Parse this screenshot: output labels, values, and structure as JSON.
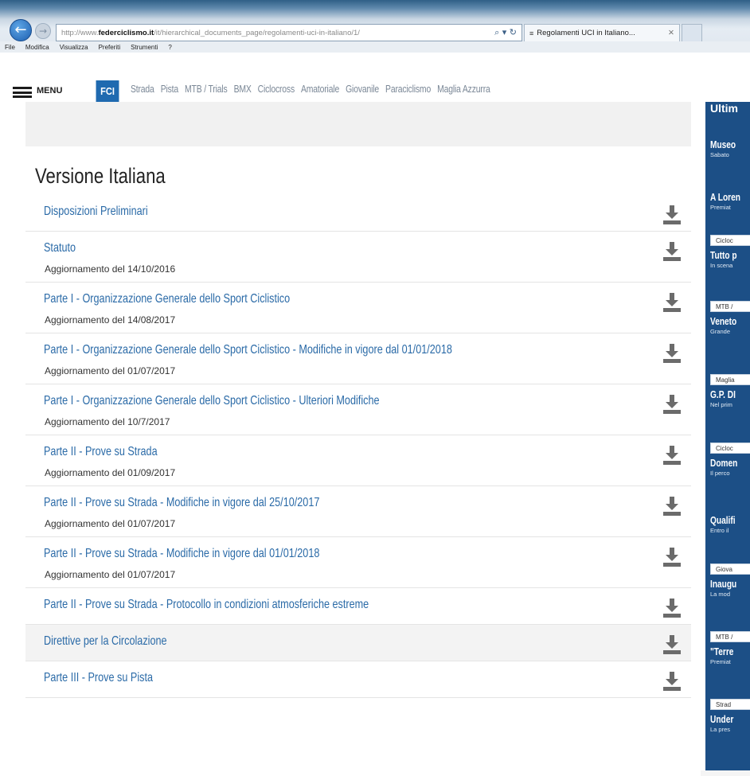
{
  "browser": {
    "url_prefix": "http://www.",
    "url_host": "federciclismo.it",
    "url_path": "/it/hierarchical_documents_page/regolamenti-uci-in-italiano/1/",
    "address_icons": "⌕ ▾ ↻",
    "tab_title": "Regolamenti UCI in Italiano...",
    "tab_close": "✕",
    "menu": [
      "File",
      "Modifica",
      "Visualizza",
      "Preferiti",
      "Strumenti",
      "?"
    ]
  },
  "site_nav": {
    "menu_label": "MENU",
    "badge": "FCI",
    "links": [
      "Strada",
      "Pista",
      "MTB / Trials",
      "BMX",
      "Ciclocross",
      "Amatoriale",
      "Giovanile",
      "Paraciclismo",
      "Maglia Azzurra"
    ]
  },
  "main": {
    "section_title": "Versione Italiana",
    "documents": [
      {
        "title": "Disposizioni Preliminari",
        "date": ""
      },
      {
        "title": "Statuto",
        "date": "Aggiornamento del 14/10/2016"
      },
      {
        "title": "Parte I - Organizzazione Generale dello Sport Ciclistico",
        "date": "Aggiornamento del 14/08/2017"
      },
      {
        "title": "Parte I - Organizzazione Generale dello Sport Ciclistico - Modifiche in vigore dal 01/01/2018",
        "date": "Aggiornamento del 01/07/2017"
      },
      {
        "title": "Parte I - Organizzazione Generale dello Sport Ciclistico - Ulteriori Modifiche",
        "date": "Aggiornamento del 10/7/2017"
      },
      {
        "title": "Parte II - Prove su Strada",
        "date": "Aggiornamento del 01/09/2017"
      },
      {
        "title": "Parte II - Prove su Strada - Modifiche in vigore dal 25/10/2017",
        "date": "Aggiornamento del 01/07/2017"
      },
      {
        "title": "Parte II - Prove su Strada - Modifiche in vigore dal 01/01/2018",
        "date": "Aggiornamento del 01/07/2017"
      },
      {
        "title": "Parte II - Prove su Strada - Protocollo in condizioni atmosferiche estreme",
        "date": ""
      },
      {
        "title": "Direttive per la Circolazione",
        "date": ""
      },
      {
        "title": "Parte III - Prove su Pista",
        "date": ""
      }
    ]
  },
  "sidebar": {
    "heading": "Ultim",
    "items": [
      {
        "title": "Museo",
        "sub": "Sabato"
      },
      {
        "title": "A Loren",
        "sub": "Premiat"
      },
      {
        "tag": "Cicloc"
      },
      {
        "title": "Tutto p",
        "sub": "In scena"
      },
      {
        "tag": "MTB /"
      },
      {
        "title": "Veneto",
        "sub": "Grande"
      },
      {
        "tag": "Maglia"
      },
      {
        "title": "G.P. DI",
        "sub": "Nel prim"
      },
      {
        "tag": "Cicloc"
      },
      {
        "title": "Domen",
        "sub": "Il perco"
      },
      {
        "title": "Qualifi",
        "sub": "Entro il"
      },
      {
        "tag": "Giova"
      },
      {
        "title": "Inaugu",
        "sub": "La mod"
      },
      {
        "tag": "MTB /"
      },
      {
        "title": "\"Terre",
        "sub": "Premiat"
      },
      {
        "tag": "Strad"
      },
      {
        "title": "Under",
        "sub": "La pres"
      }
    ]
  },
  "colors": {
    "link": "#2a6aa7",
    "fci_badge": "#1f6ab0",
    "sidebar_bg": "#1c4f86",
    "download_icon": "#6b6b6b"
  }
}
